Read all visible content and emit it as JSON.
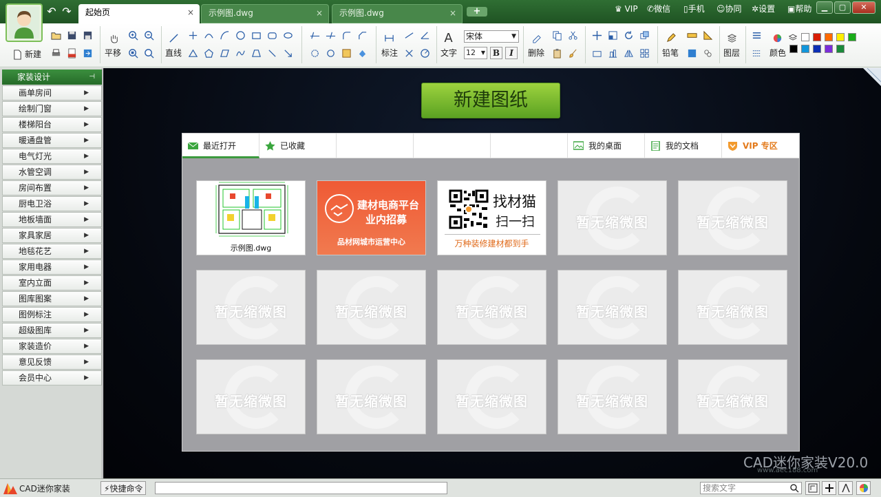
{
  "tabs": [
    {
      "label": "起始页",
      "active": true
    },
    {
      "label": "示例图.dwg",
      "active": false
    },
    {
      "label": "示例图.dwg",
      "active": false
    }
  ],
  "tab_close_glyph": "×",
  "top_menu": {
    "vip": "VIP",
    "wechat": "微信",
    "phone": "手机",
    "collab": "协同",
    "settings": "设置",
    "help": "帮助"
  },
  "toolbar": {
    "new_label": "新建",
    "pan_label": "平移",
    "line_label": "直线",
    "dimension_label": "标注",
    "text_label": "文字",
    "font_name": "宋体",
    "font_size": "12",
    "bold": "B",
    "italic": "I",
    "delete_label": "删除",
    "pencil_label": "铅笔",
    "layer_label": "图层",
    "color_label": "颜色"
  },
  "colors": {
    "swatches_top": [
      "#ffffff",
      "#d81e06",
      "#ff6a00",
      "#ffee00",
      "#1aac19"
    ],
    "swatches_bottom": [
      "#000000",
      "#1296db",
      "#0b2fb5",
      "#7b2ed9",
      "#1a8a3a"
    ]
  },
  "sidebar": {
    "header": "家装设计",
    "items": [
      "画单房间",
      "绘制门窗",
      "楼梯阳台",
      "暖通盘管",
      "电气灯光",
      "水管空调",
      "房间布置",
      "厨电卫浴",
      "地板墙面",
      "家具家居",
      "地毯花艺",
      "家用电器",
      "室内立面",
      "图库图案",
      "图例标注",
      "超级图库",
      "家装造价",
      "意见反馈",
      "会员中心"
    ]
  },
  "main": {
    "new_drawing": "新建图纸",
    "panel_tabs": {
      "recent": "最近打开",
      "favorites": "已收藏",
      "desktop": "我的桌面",
      "documents": "我的文档",
      "vip": "VIP 专区"
    },
    "thumb_caption": "示例图.dwg",
    "promo1": {
      "line1": "建材电商平台",
      "line2": "业内招募",
      "line3": "品材网城市运营中心"
    },
    "promo2": {
      "title": "找材猫",
      "subtitle": "扫一扫",
      "footer": "万种装修建材都到手"
    },
    "placeholder": "暂无缩微图"
  },
  "statusbar": {
    "app_name": "CAD迷你家装",
    "quick_cmd": "快捷命令",
    "search_placeholder": "搜索文字"
  },
  "watermark": {
    "text": "CAD迷你家装V20.0",
    "site": "www.aec188.com"
  }
}
